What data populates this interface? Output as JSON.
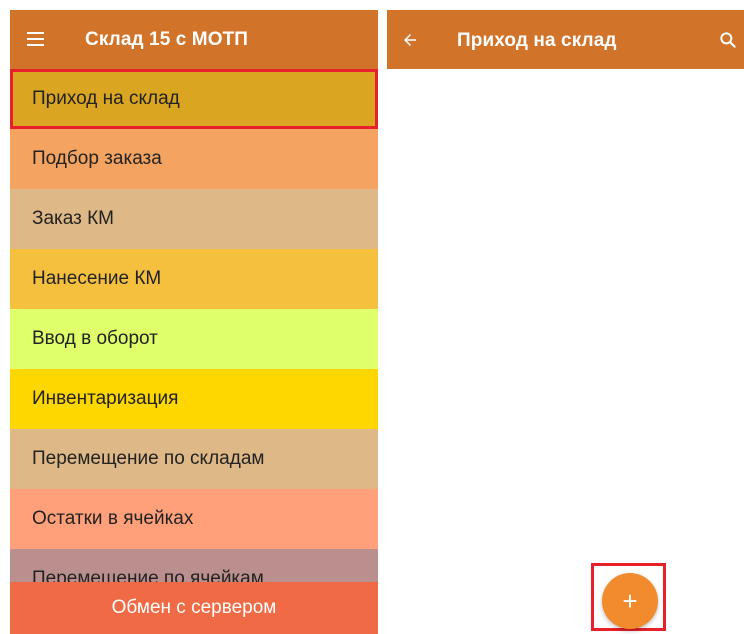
{
  "left_screen": {
    "app_title": "Склад 15 с МОТП",
    "menu_items": [
      {
        "label": "Приход на склад",
        "color": "#DAA520"
      },
      {
        "label": "Подбор заказа",
        "color": "#F4A460"
      },
      {
        "label": "Заказ КМ",
        "color": "#DEB887"
      },
      {
        "label": "Нанесение КМ",
        "color": "#F5C03E"
      },
      {
        "label": "Ввод в оборот",
        "color": "#DFFF6B"
      },
      {
        "label": "Инвентаризация",
        "color": "#FFD700"
      },
      {
        "label": "Перемещение по складам",
        "color": "#DEB887"
      },
      {
        "label": "Остатки в ячейках",
        "color": "#FFA07A"
      },
      {
        "label": "Перемещение по ячейкам",
        "color": "#BC8F8F"
      }
    ],
    "sync_button_label": "Обмен с сервером"
  },
  "right_screen": {
    "title": "Приход на склад",
    "fab_label": "+"
  },
  "colors": {
    "appbar": "#D2732A",
    "highlight": "#E8202A",
    "sync_button": "#F06A45",
    "fab": "#F28A2E"
  }
}
